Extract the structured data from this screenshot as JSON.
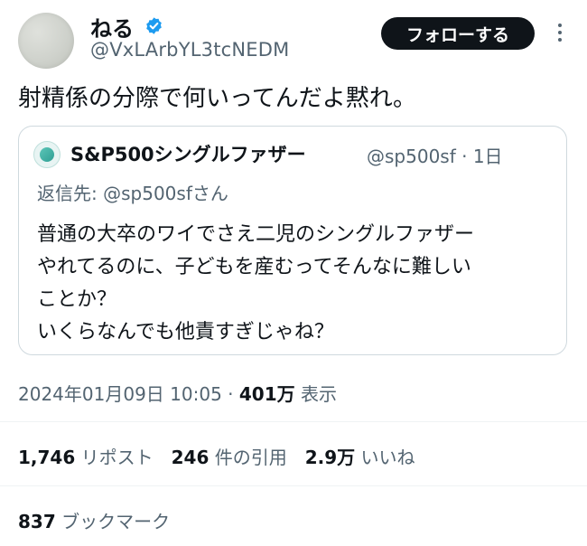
{
  "author": {
    "display_name": "ねる",
    "handle": "@VxLArbYL3tcNEDM",
    "verified": true
  },
  "follow_button": "フォローする",
  "tweet_text": "射精係の分際で何いってんだよ黙れ。",
  "quoted": {
    "display_name": "S&P500シングルファザー",
    "handle_time": "@sp500sf · 1日",
    "reply_prefix": "返信先: ",
    "reply_to": "@sp500sfさん",
    "body_lines": [
      "普通の大卒のワイでさえ二児のシングルファザー",
      "やれてるのに、子どもを産むってそんなに難しい",
      "ことか？",
      "いくらなんでも他責すぎじゃね？"
    ]
  },
  "meta": {
    "timestamp": "2024年01月09日 10:05",
    "separator": " · ",
    "views_count": "401万",
    "views_label": " 表示"
  },
  "stats": {
    "reposts_count": "1,746",
    "reposts_label": " リポスト",
    "quotes_count": "246",
    "quotes_label": " 件の引用",
    "likes_count": "2.9万",
    "likes_label": " いいね"
  },
  "bookmarks": {
    "count": "837",
    "label": " ブックマーク"
  },
  "colors": {
    "text": "#0f1419",
    "secondary": "#536471",
    "verified": "#1d9bf0",
    "border": "#cfd9de"
  }
}
